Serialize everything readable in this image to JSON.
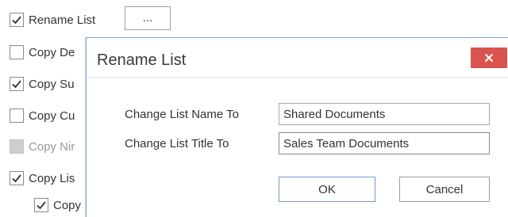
{
  "background_options": {
    "items": [
      {
        "label": "Rename List",
        "checked": true,
        "enabled": true
      },
      {
        "label": "Copy De",
        "checked": false,
        "enabled": true
      },
      {
        "label": "Copy Su",
        "checked": true,
        "enabled": true
      },
      {
        "label": "Copy Cu",
        "checked": false,
        "enabled": true
      },
      {
        "label": "Copy Nir",
        "checked": false,
        "enabled": false
      },
      {
        "label": "Copy Lis",
        "checked": true,
        "enabled": true
      },
      {
        "label": "Copy",
        "checked": true,
        "enabled": true
      }
    ],
    "ellipsis_button_label": "..."
  },
  "dialog": {
    "title": "Rename List",
    "close_icon": "close-icon",
    "fields": {
      "name_label": "Change List Name To",
      "name_value": "Shared Documents",
      "title_label": "Change List Title To",
      "title_value": "Sales Team Documents"
    },
    "buttons": {
      "ok_label": "OK",
      "cancel_label": "Cancel"
    }
  },
  "colors": {
    "close_button_bg": "#d9534f",
    "dialog_border": "#7fa6d6",
    "disabled_checkbox": "#cfcfcf"
  }
}
